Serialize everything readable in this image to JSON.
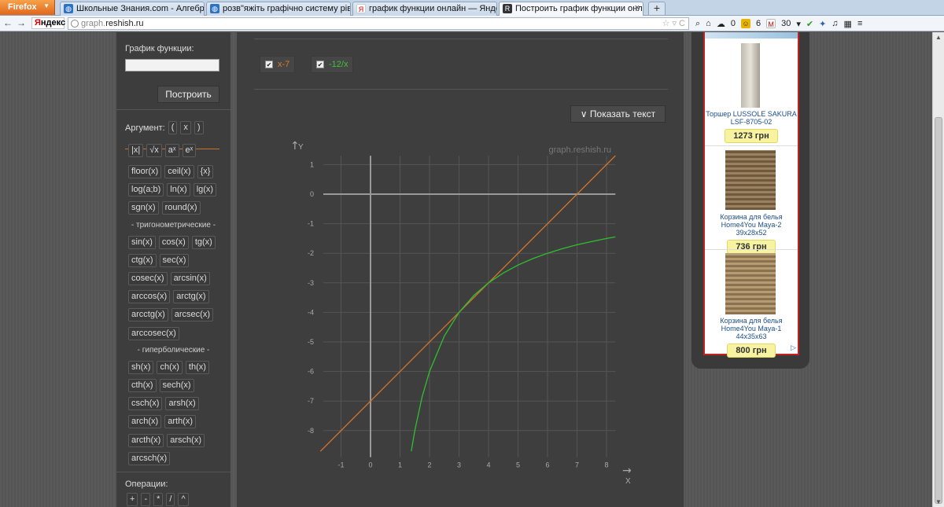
{
  "browser": {
    "firefox_label": "Firefox",
    "tabs": [
      {
        "label": "Школьные Знания.com - Алгебра",
        "favicon": "globe-blue"
      },
      {
        "label": "розв\"яжіть графічно систему рів... -...",
        "favicon": "globe-blue"
      },
      {
        "label": "график функции онлайн — Яндекс: ...",
        "favicon": "yandex-y"
      },
      {
        "label": "Построить график функции онлайн",
        "favicon": "reshish-r"
      }
    ],
    "new_tab_label": "+",
    "yandex_logo_first": "Я",
    "yandex_logo_rest": "ндекс",
    "url_prefix": "graph.",
    "url_host": "reshish.ru",
    "toolbar": {
      "count_a": "0",
      "count_b": "6",
      "mail_count": "30"
    }
  },
  "sidebar": {
    "function_label": "График функции:",
    "build_button": "Построить",
    "argument_label": "Аргумент:",
    "argument_chips": [
      "(",
      "x",
      ")"
    ],
    "top_chips": [
      "|x|",
      "√x",
      "aˣ",
      "eˣ"
    ],
    "rows": [
      [
        "floor(x)",
        "ceil(x)",
        "{x}"
      ],
      [
        "log(a;b)",
        "ln(x)",
        "lg(x)"
      ],
      [
        "sgn(x)",
        "round(x)"
      ]
    ],
    "trig_header": "- тригонометрические -",
    "trig_rows": [
      [
        "sin(x)",
        "cos(x)",
        "tg(x)"
      ],
      [
        "ctg(x)",
        "sec(x)"
      ],
      [
        "cosec(x)",
        "arcsin(x)"
      ],
      [
        "arccos(x)",
        "arctg(x)"
      ],
      [
        "arcctg(x)",
        "arcsec(x)"
      ],
      [
        "arccosec(x)"
      ]
    ],
    "hyp_header": "- гиперболические -",
    "hyp_rows": [
      [
        "sh(x)",
        "ch(x)",
        "th(x)"
      ],
      [
        "cth(x)",
        "sech(x)"
      ],
      [
        "csch(x)",
        "arsh(x)"
      ],
      [
        "arch(x)",
        "arth(x)"
      ],
      [
        "arcth(x)",
        "arsch(x)"
      ],
      [
        "arcsch(x)"
      ]
    ],
    "ops_label": "Операции:",
    "ops": [
      "+",
      "-",
      "*",
      "/",
      "^"
    ]
  },
  "main": {
    "series_chips": [
      {
        "label": "x-7",
        "color": "#e07a1e"
      },
      {
        "label": "-12/x",
        "color": "#3ec23e"
      }
    ],
    "show_text_button": "∨ Показать текст",
    "watermark": "graph.reshish.ru"
  },
  "chart_data": {
    "type": "line",
    "xlabel": "X",
    "ylabel": "Y",
    "xlim": [
      -1.6,
      8.3
    ],
    "ylim": [
      -8.9,
      1.3
    ],
    "x_ticks": [
      -1,
      0,
      1,
      2,
      3,
      4,
      5,
      6,
      7,
      8
    ],
    "y_ticks": [
      1,
      0,
      -1,
      -2,
      -3,
      -4,
      -5,
      -6,
      -7,
      -8
    ],
    "grid": true,
    "series": [
      {
        "name": "x-7",
        "color": "#d8742a",
        "x": [
          -1.7,
          8.3
        ],
        "y": [
          -8.7,
          1.3
        ]
      },
      {
        "name": "-12/x",
        "color": "#2fbf2f",
        "x": [
          1.38,
          1.5,
          1.75,
          2,
          2.5,
          3,
          3.5,
          4,
          4.5,
          5,
          5.5,
          6,
          6.5,
          7,
          7.5,
          8,
          8.3
        ],
        "y": [
          -8.7,
          -8,
          -6.857,
          -6,
          -4.8,
          -4,
          -3.429,
          -3,
          -2.667,
          -2.4,
          -2.182,
          -2,
          -1.846,
          -1.714,
          -1.6,
          -1.5,
          -1.446
        ]
      }
    ]
  },
  "ads": [
    {
      "title": "Торшер LUSSOLE SAKURA LSF-8705-02",
      "price": "1273 грн"
    },
    {
      "title": "Корзина для белья Home4You Maya-2 39x28x52",
      "price": "736 грн"
    },
    {
      "title": "Корзина для белья Home4You Maya-1 44x35x63",
      "price": "800 грн"
    }
  ]
}
